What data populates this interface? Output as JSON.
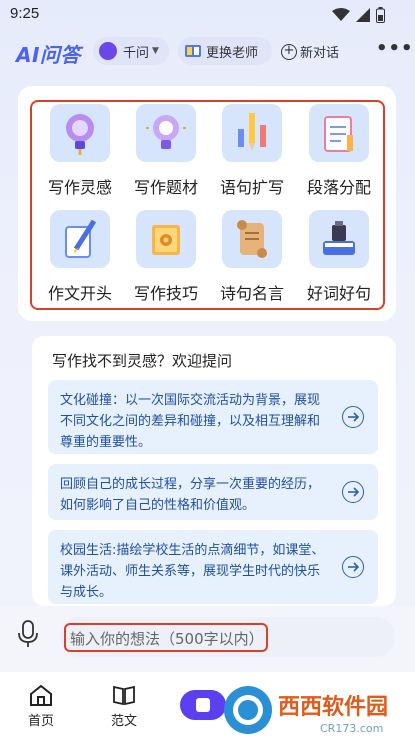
{
  "status": {
    "time": "9:25"
  },
  "header": {
    "logo": "AI问答",
    "model_label": "千问",
    "teacher_label": "更换老师",
    "new_chat_label": "新对话"
  },
  "tools": [
    {
      "label": "写作灵感",
      "icon": "lightbulb-icon"
    },
    {
      "label": "写作题材",
      "icon": "bulb-idea-icon"
    },
    {
      "label": "语句扩写",
      "icon": "pencils-icon"
    },
    {
      "label": "段落分配",
      "icon": "notepad-icon"
    },
    {
      "label": "作文开头",
      "icon": "pen-paper-icon"
    },
    {
      "label": "写作技巧",
      "icon": "book-gear-icon"
    },
    {
      "label": "诗句名言",
      "icon": "scroll-icon"
    },
    {
      "label": "好词好句",
      "icon": "ink-book-icon"
    }
  ],
  "suggestions": {
    "title": "写作找不到灵感？欢迎提问",
    "items": [
      "文化碰撞：以一次国际交流活动为背景，展现不同文化之间的差异和碰撞，以及相互理解和尊重的重要性。",
      "回顾自己的成长过程，分享一次重要的经历，如何影响了自己的性格和价值观。",
      "校园生活:描绘学校生活的点滴细节，如课堂、课外活动、师生关系等，展现学生时代的快乐与成长。"
    ]
  },
  "input": {
    "placeholder": "输入你的想法（500字以内）"
  },
  "nav": {
    "home": "首页",
    "essay": "范文"
  },
  "watermark": {
    "brand": "西西软件园",
    "site": "CR173.com"
  },
  "colors": {
    "accent": "#4b63f0",
    "highlight": "#d9402c",
    "tile": "#d6e5fb",
    "suggestion_bg": "#e7f0fd",
    "suggestion_text": "#1f4f9e"
  }
}
